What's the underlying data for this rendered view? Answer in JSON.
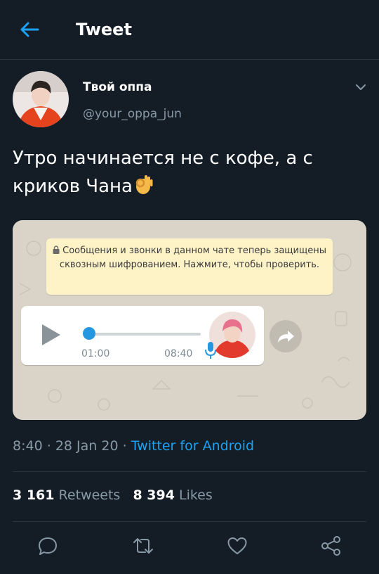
{
  "header": {
    "title": "Tweet",
    "back_icon": "arrow-left-icon"
  },
  "author": {
    "name": "Твой оппа",
    "handle": "@your_oppa_jun"
  },
  "tweet": {
    "text": "Утро начинается не с кофе, а с криков Чана",
    "emoji": "ok-hand-emoji"
  },
  "media": {
    "encryption_notice": "Сообщения и звонки в данном чате теперь защищены сквозным шифрованием. Нажмите, чтобы проверить.",
    "voice_message": {
      "current_time": "01:00",
      "sent_time": "08:40",
      "progress": 0.0
    }
  },
  "meta": {
    "time": "8:40",
    "date": "28 Jan 20",
    "source": "Twitter for Android",
    "separator": "·"
  },
  "stats": {
    "retweets_count": "3 161",
    "retweets_label": "Retweets",
    "likes_count": "8 394",
    "likes_label": "Likes"
  },
  "actions": [
    "reply-icon",
    "retweet-icon",
    "like-icon",
    "share-icon"
  ],
  "colors": {
    "background": "#141d26",
    "accent": "#1da1f2",
    "secondary_text": "#8899a6",
    "voice_accent": "#2596e0"
  }
}
